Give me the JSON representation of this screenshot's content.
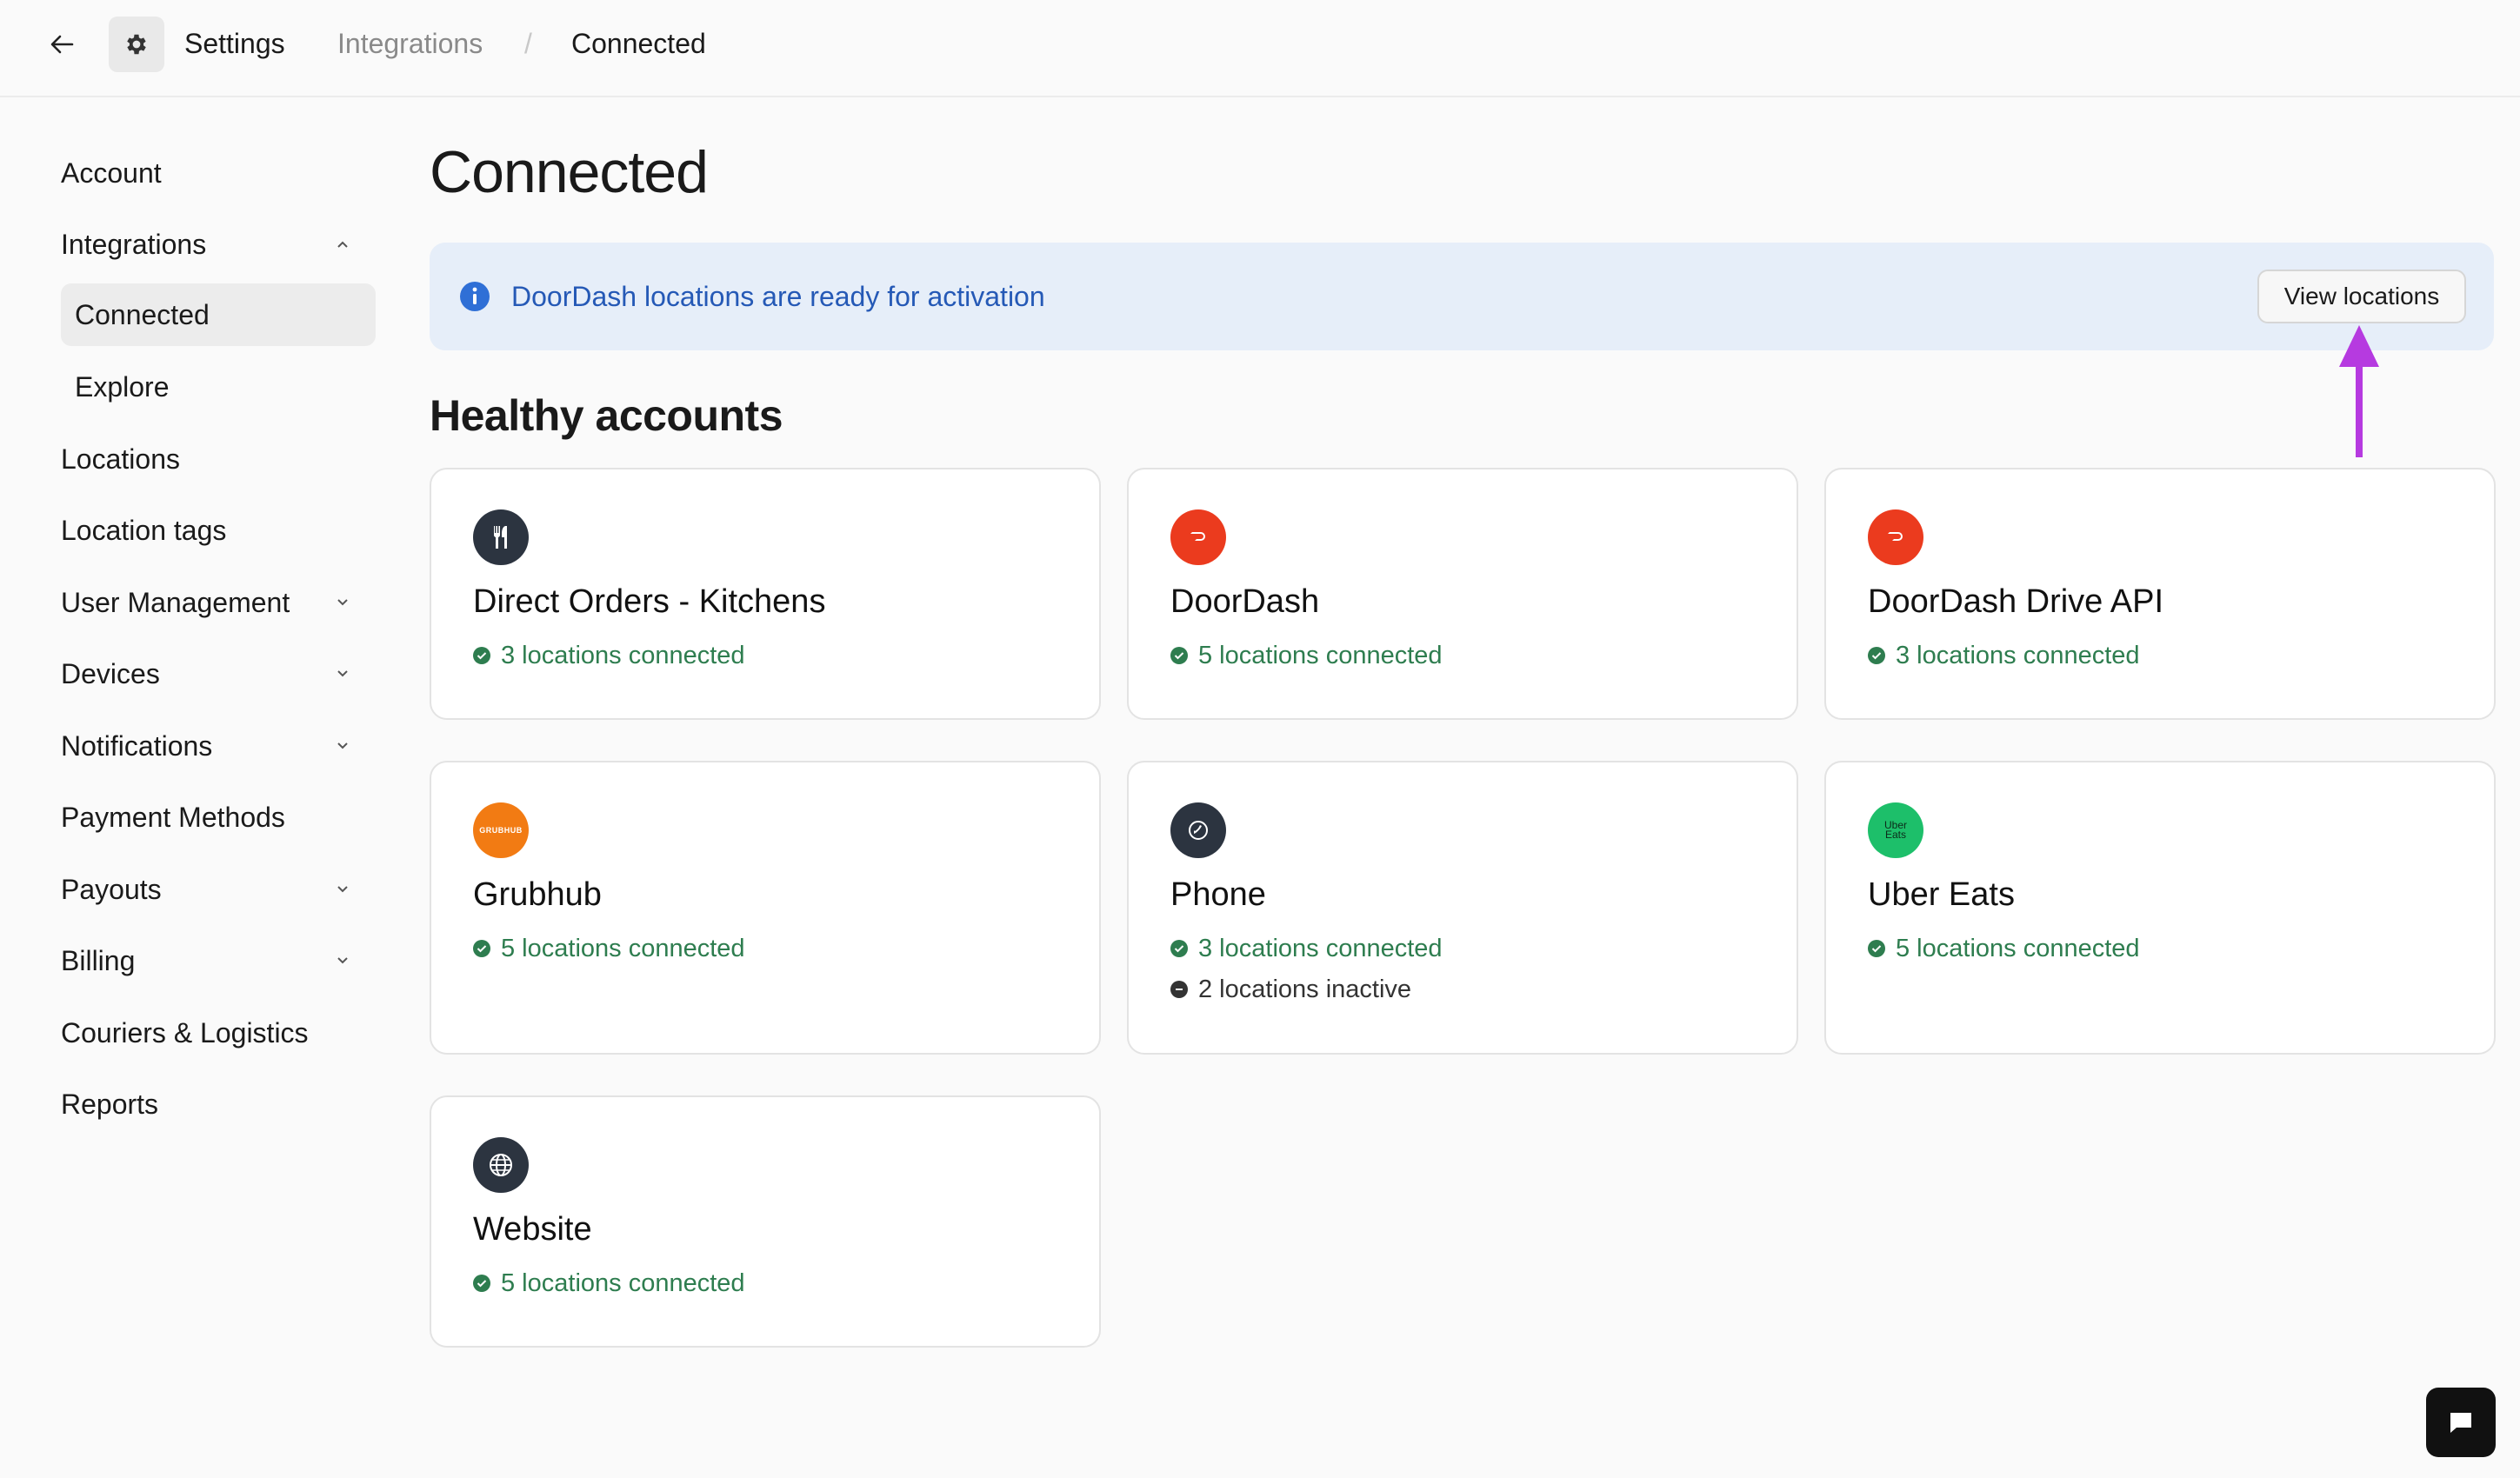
{
  "breadcrumb": {
    "settings": "Settings",
    "integrations": "Integrations",
    "separator": "/",
    "current": "Connected"
  },
  "sidebar": {
    "items": [
      {
        "label": "Account"
      },
      {
        "label": "Integrations",
        "icon": "chevron-up-icon"
      },
      {
        "label": "Connected",
        "active": true
      },
      {
        "label": "Explore"
      },
      {
        "label": "Locations"
      },
      {
        "label": "Location tags"
      },
      {
        "label": "User Management",
        "icon": "chevron-down-icon"
      },
      {
        "label": "Devices",
        "icon": "chevron-down-icon"
      },
      {
        "label": "Notifications",
        "icon": "chevron-down-icon"
      },
      {
        "label": "Payment Methods"
      },
      {
        "label": "Payouts",
        "icon": "chevron-down-icon"
      },
      {
        "label": "Billing",
        "icon": "chevron-down-icon"
      },
      {
        "label": "Couriers & Logistics"
      },
      {
        "label": "Reports"
      }
    ]
  },
  "main": {
    "title": "Connected",
    "banner": {
      "message": "DoorDash locations are ready for activation",
      "button": "View locations"
    },
    "section_title": "Healthy accounts",
    "cards": [
      {
        "name": "Direct Orders - Kitchens",
        "logo": "fork-knife-icon",
        "status": [
          "3 locations connected"
        ]
      },
      {
        "name": "DoorDash",
        "logo": "doordash-logo",
        "status": [
          "5 locations connected"
        ]
      },
      {
        "name": "DoorDash Drive API",
        "logo": "doordash-logo",
        "status": [
          "3 locations connected"
        ]
      },
      {
        "name": "Grubhub",
        "logo": "grubhub-logo",
        "logo_text": "GRUBHUB",
        "status": [
          "5 locations connected"
        ]
      },
      {
        "name": "Phone",
        "logo": "phone-icon",
        "status": [
          "3 locations connected",
          "2 locations inactive"
        ]
      },
      {
        "name": "Uber Eats",
        "logo": "uber-eats-logo",
        "logo_text": [
          "Uber",
          "Eats"
        ],
        "status": [
          "5 locations connected"
        ]
      },
      {
        "name": "Website",
        "logo": "globe-icon",
        "status": [
          "5 locations connected"
        ]
      }
    ]
  },
  "colors": {
    "accent_blue": "#2559b6",
    "banner_bg": "#e6eef9",
    "success_green": "#2e7d4f",
    "doordash_red": "#eb3b1e",
    "grubhub_orange": "#f27b13",
    "uber_eats_green": "#1dbf6a",
    "annotation_purple": "#b63ae0"
  }
}
